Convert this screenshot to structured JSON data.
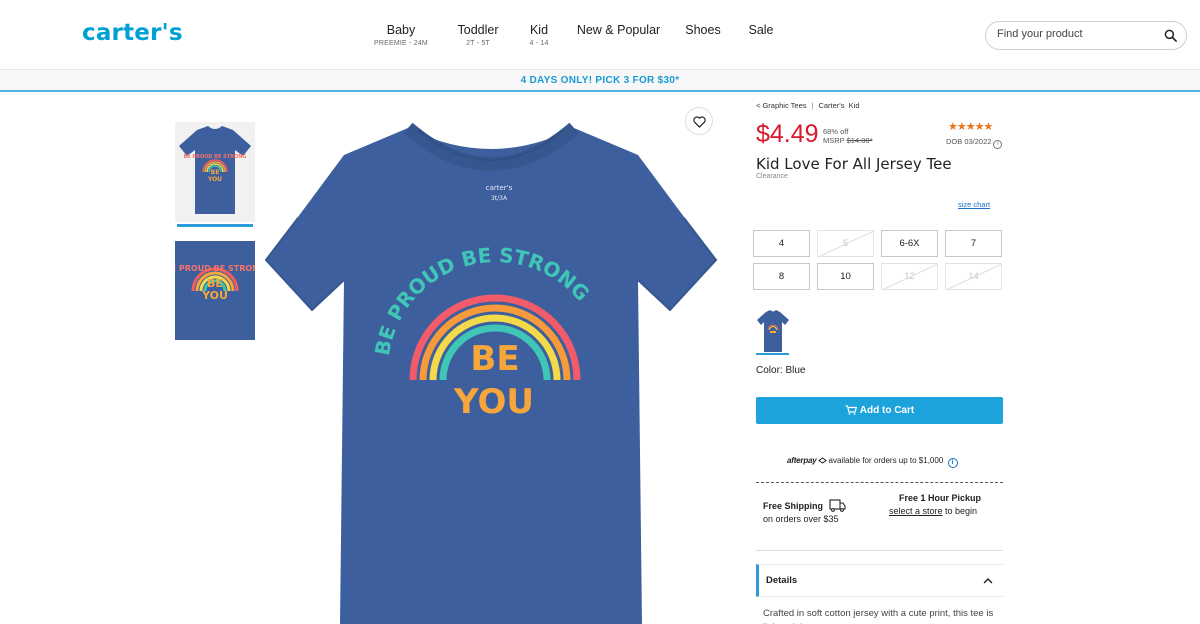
{
  "header": {
    "logo": "carter's",
    "nav": [
      {
        "label": "Baby",
        "sub": "PREEMIE - 24M"
      },
      {
        "label": "Toddler",
        "sub": "2T - 5T"
      },
      {
        "label": "Kid",
        "sub": "4 - 14"
      },
      {
        "label": "New & Popular",
        "sub": ""
      },
      {
        "label": "Shoes",
        "sub": ""
      },
      {
        "label": "Sale",
        "sub": ""
      }
    ],
    "search_placeholder": "Find your product"
  },
  "promo": "4 DAYS ONLY! PICK 3 FOR $30*",
  "product": {
    "breadcrumb": [
      "< Graphic Tees",
      "Carter's",
      "Kid"
    ],
    "price": "$4.49",
    "discount": "68% off",
    "msrp_label": "MSRP",
    "msrp": "$14.00*",
    "rating_stars": "★★★★★",
    "dob": "DOB 03/2022",
    "title": "Kid Love For All Jersey Tee",
    "style_number": "Clearance",
    "size_chart": "size chart",
    "sizes": [
      {
        "label": "4",
        "available": true
      },
      {
        "label": "5",
        "available": false
      },
      {
        "label": "6-6X",
        "available": true
      },
      {
        "label": "7",
        "available": true
      },
      {
        "label": "8",
        "available": true
      },
      {
        "label": "10",
        "available": true
      },
      {
        "label": "12",
        "available": false
      },
      {
        "label": "14",
        "available": false
      }
    ],
    "color_label": "Color: Blue",
    "add_to_cart": "Add to Cart",
    "afterpay_brand": "afterpay",
    "afterpay_text": "available for orders up to $1,000",
    "shipping_title": "Free Shipping",
    "shipping_sub": "on orders over $35",
    "pickup_title": "Free 1 Hour Pickup",
    "pickup_link": "select a store",
    "pickup_rest": " to begin",
    "details_label": "Details",
    "description": "Crafted in soft cotton jersey with a cute print, this tee is lightweight"
  },
  "shirt_print": {
    "arc_text": "BE PROUD BE STRONG",
    "be": "BE",
    "you": "YOU",
    "tag_brand": "carter's",
    "tag_size": "3t/3A"
  },
  "colors": {
    "brand_blue": "#00a0d6",
    "sale_red": "#d8182b",
    "cta_blue": "#1ca3dc",
    "shirt_blue": "#3d5f9e",
    "star_orange": "#e8731b"
  }
}
